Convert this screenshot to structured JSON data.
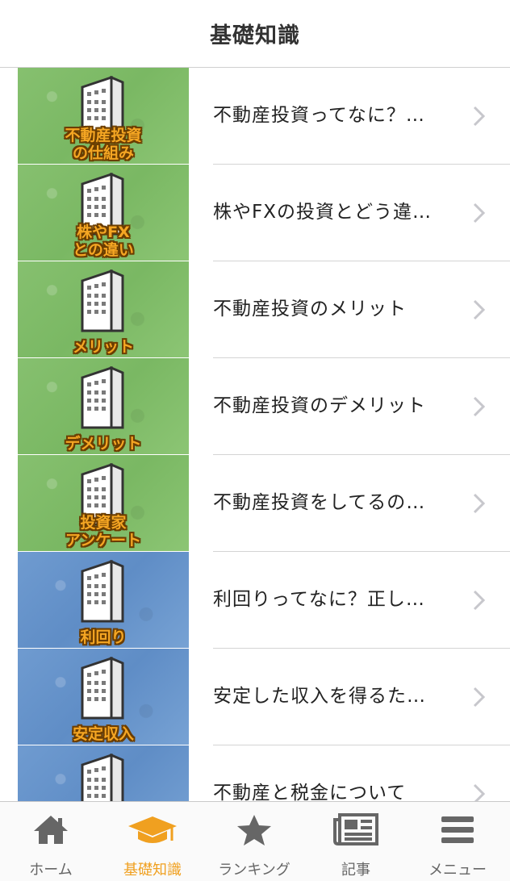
{
  "header": {
    "title": "基礎知識"
  },
  "items": [
    {
      "title": "不動産投資ってなに？…",
      "thumb_label": "不動産投資\nの仕組み",
      "thumb_color": "green"
    },
    {
      "title": "株やFXの投資とどう違…",
      "thumb_label": "株やFX\nとの違い",
      "thumb_color": "green"
    },
    {
      "title": "不動産投資のメリット",
      "thumb_label": "メリット",
      "thumb_color": "green"
    },
    {
      "title": "不動産投資のデメリット",
      "thumb_label": "デメリット",
      "thumb_color": "green"
    },
    {
      "title": "不動産投資をしてるの…",
      "thumb_label": "投資家\nアンケート",
      "thumb_color": "green"
    },
    {
      "title": "利回りってなに？正し…",
      "thumb_label": "利回り",
      "thumb_color": "blue"
    },
    {
      "title": "安定した収入を得るた…",
      "thumb_label": "安定収入",
      "thumb_color": "blue"
    },
    {
      "title": "不動産と税金について",
      "thumb_label": "",
      "thumb_color": "blue"
    }
  ],
  "tabbar": {
    "tabs": [
      {
        "label": "ホーム",
        "icon": "home-icon"
      },
      {
        "label": "基礎知識",
        "icon": "graduation-cap-icon",
        "active": true
      },
      {
        "label": "ランキング",
        "icon": "star-icon"
      },
      {
        "label": "記事",
        "icon": "newspaper-icon"
      },
      {
        "label": "メニュー",
        "icon": "menu-icon"
      }
    ]
  },
  "colors": {
    "accent": "#f0a020",
    "inactive": "#666666",
    "thumb_green": "#7ab863",
    "thumb_blue": "#5f8dc6"
  }
}
